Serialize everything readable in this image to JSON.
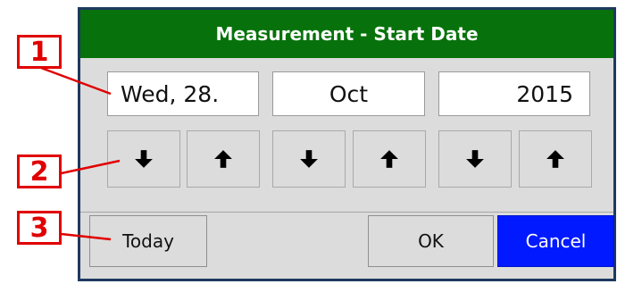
{
  "dialog": {
    "title": "Measurement - Start Date",
    "fields": {
      "day": "Wed, 28.",
      "month": "Oct",
      "year": "2015"
    },
    "arrows": [
      {
        "name": "day-down-button",
        "direction": "down"
      },
      {
        "name": "day-up-button",
        "direction": "up"
      },
      {
        "name": "month-down-button",
        "direction": "down"
      },
      {
        "name": "month-up-button",
        "direction": "up"
      },
      {
        "name": "year-down-button",
        "direction": "down"
      },
      {
        "name": "year-up-button",
        "direction": "up"
      }
    ],
    "buttons": {
      "today": "Today",
      "ok": "OK",
      "cancel": "Cancel"
    }
  },
  "callouts": [
    "1",
    "2",
    "3"
  ],
  "colors": {
    "title_bar": "#07720b",
    "background": "#dcdcdc",
    "cancel_button": "#0019ff",
    "callout": "#e00000",
    "dialog_border": "#1d3a5f"
  },
  "icons": [
    "arrow-down-icon",
    "arrow-up-icon"
  ]
}
